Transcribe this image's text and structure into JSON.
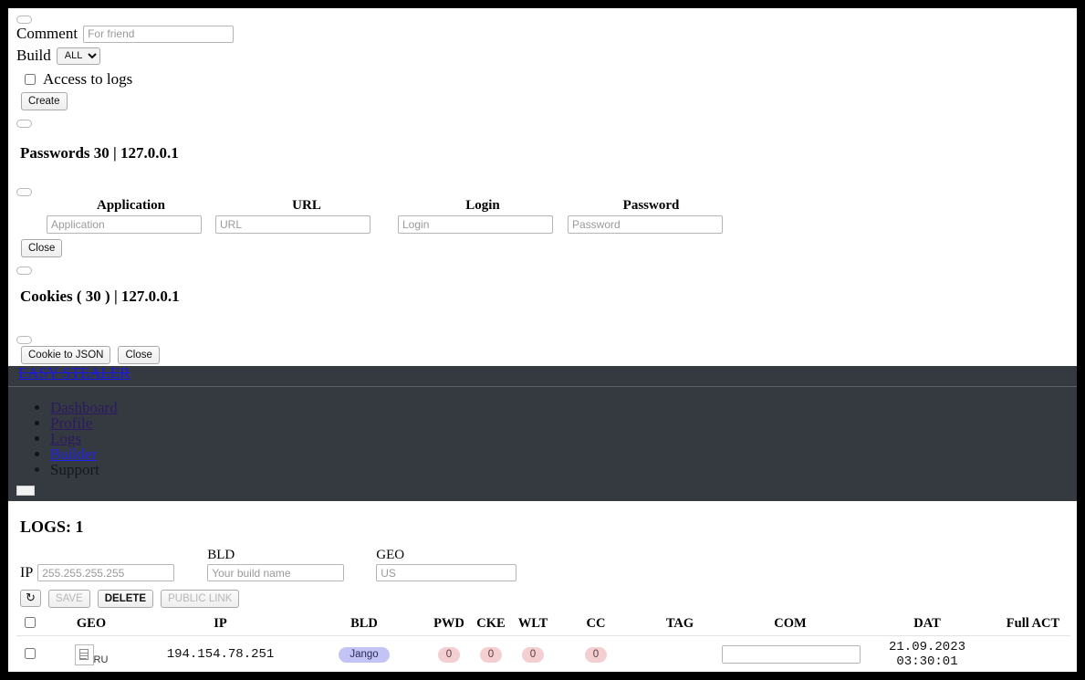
{
  "create_form": {
    "comment_label": "Comment",
    "comment_placeholder": "For friend",
    "comment_value": "",
    "build_label": "Build",
    "build_selected": "ALL",
    "build_options": [
      "ALL"
    ],
    "access_logs_label": "Access to logs",
    "create_button": "Create"
  },
  "passwords": {
    "heading": "Passwords 30 | 127.0.0.1",
    "columns": [
      "Application",
      "URL",
      "Login",
      "Password"
    ],
    "placeholders": [
      "Application",
      "URL",
      "Login",
      "Password"
    ],
    "values": [
      "",
      "",
      "",
      ""
    ],
    "close_button": "Close"
  },
  "cookies": {
    "heading": "Cookies ( 30 ) | 127.0.0.1",
    "to_json_button": "Cookie to JSON",
    "close_button": "Close"
  },
  "navbar": {
    "brand": "EASY STEALER",
    "items": [
      {
        "label": "Dashboard",
        "state": "visited"
      },
      {
        "label": "Profile",
        "state": "visited"
      },
      {
        "label": "Logs",
        "state": "visited"
      },
      {
        "label": "Builder",
        "state": "active"
      },
      {
        "label": "Support",
        "state": "plain"
      }
    ]
  },
  "logs": {
    "title": "LOGS: 1",
    "filters": {
      "ip_label": "IP",
      "ip_placeholder": "255.255.255.255",
      "ip_value": "",
      "bld_label": "BLD",
      "bld_placeholder": "Your build name",
      "bld_value": "",
      "geo_label": "GEO",
      "geo_placeholder": "US",
      "geo_value": ""
    },
    "actions": {
      "refresh_icon": "refresh-icon",
      "refresh_glyph": "↻",
      "save_label": "SAVE",
      "save_enabled": false,
      "delete_label": "DELETE",
      "delete_enabled": true,
      "public_link_label": "PUBLIC LINK",
      "public_link_enabled": false
    },
    "table": {
      "columns": [
        "GEO",
        "IP",
        "BLD",
        "PWD",
        "CKE",
        "WLT",
        "CC",
        "TAG",
        "COM",
        "DAT",
        "Full ACT"
      ],
      "rows": [
        {
          "geo_code": "RU",
          "geo_icon": "broken-image-icon",
          "ip": "194.154.78.251",
          "bld": "Jango",
          "pwd": "0",
          "cke": "0",
          "wlt": "0",
          "cc": "0",
          "tag": "",
          "com": "",
          "dat": "21.09.2023 03:30:01",
          "full_act": ""
        }
      ]
    }
  },
  "colors": {
    "navbar_bg": "#343a40",
    "brand_link": "#1a18e8",
    "active_link": "#2222ee",
    "visited_link": "#2b1a63",
    "badge_bld_bg": "#c3c4f5",
    "badge_count_bg": "#f3cfd2"
  }
}
